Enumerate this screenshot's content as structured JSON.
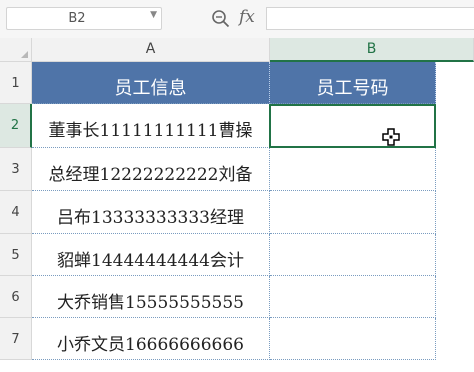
{
  "formula_bar": {
    "name_box": "B2",
    "fx_label": "fx",
    "formula_value": ""
  },
  "columns": [
    "A",
    "B"
  ],
  "rows": [
    "1",
    "2",
    "3",
    "4",
    "5",
    "6",
    "7"
  ],
  "selected_cell": "B2",
  "table": {
    "headers": [
      "员工信息",
      "员工号码"
    ],
    "data": [
      [
        "董事长11111111111曹操",
        ""
      ],
      [
        "总经理12222222222刘备",
        ""
      ],
      [
        "吕布13333333333经理",
        ""
      ],
      [
        "貂蝉14444444444会计",
        ""
      ],
      [
        "大乔销售15555555555",
        ""
      ],
      [
        "小乔文员16666666666",
        ""
      ]
    ]
  },
  "colors": {
    "header_fill": "#4f74a8",
    "header_text": "#ffffff",
    "selection": "#217346"
  },
  "icons": [
    "zoom-icon",
    "fx-icon",
    "dropdown-arrow-icon",
    "cross-cursor-icon"
  ]
}
